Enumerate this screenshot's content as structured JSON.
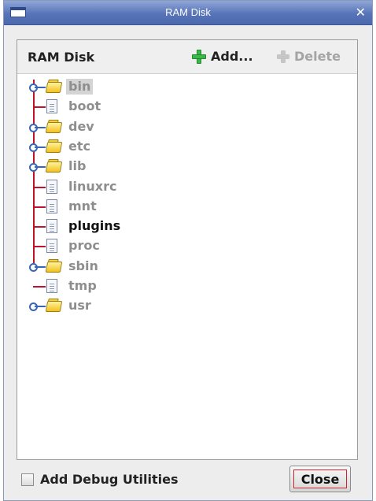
{
  "window": {
    "title": "RAM Disk"
  },
  "panel": {
    "title": "RAM Disk",
    "add_label": "Add...",
    "delete_label": "Delete"
  },
  "tree": {
    "items": [
      {
        "label": "bin",
        "type": "folder",
        "selected": true
      },
      {
        "label": "boot",
        "type": "file"
      },
      {
        "label": "dev",
        "type": "folder"
      },
      {
        "label": "etc",
        "type": "folder"
      },
      {
        "label": "lib",
        "type": "folder"
      },
      {
        "label": "linuxrc",
        "type": "file"
      },
      {
        "label": "mnt",
        "type": "file"
      },
      {
        "label": "plugins",
        "type": "file",
        "emphasized": true
      },
      {
        "label": "proc",
        "type": "file"
      },
      {
        "label": "sbin",
        "type": "folder"
      },
      {
        "label": "tmp",
        "type": "file"
      },
      {
        "label": "usr",
        "type": "folder"
      }
    ]
  },
  "footer": {
    "checkbox_label": "Add Debug Utilities",
    "checkbox_checked": false,
    "close_label": "Close"
  },
  "icons": {
    "add": "plus-green-icon",
    "delete": "plus-gray-icon",
    "folder": "folder-icon",
    "file": "file-icon",
    "expand": "tree-expand-handle-icon"
  },
  "colors": {
    "titlebar": "#5774b8",
    "tree_line": "#c0122b",
    "focus_ring": "#d2232a"
  }
}
